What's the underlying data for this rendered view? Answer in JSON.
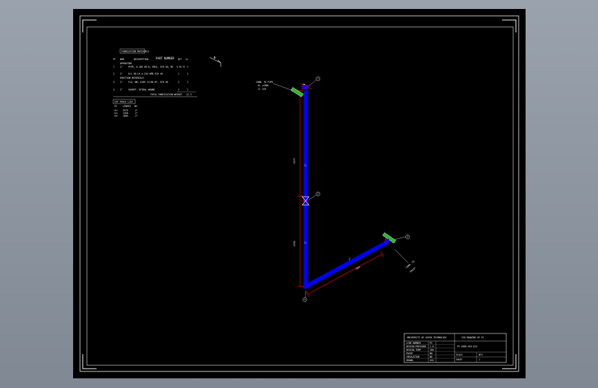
{
  "colors": {
    "background": "#8d96a1",
    "sheet": "#000000",
    "frame": "#ffffff",
    "pipe": "#0000ff",
    "dimension": "#ff0000",
    "fitting": "#2db82d"
  },
  "bom": {
    "header": "FABRICATION MATERIALS",
    "title": "PART NUMBER",
    "columns": [
      "PT",
      "NOM",
      "DESCRIPTION",
      "QTY",
      "CL"
    ],
    "rows": [
      {
        "pt": "1",
        "nom": "2\"",
        "desc": "PIPE, A-106 GR.B, SMLS, SCH 40, BE",
        "qty": "5.61 M",
        "cl": "1"
      },
      {
        "pt": "2",
        "nom": "2\"",
        "desc": "ELL 90 LR A-234 WPB SCH 40",
        "qty": "1",
        "cl": "1"
      },
      {
        "pt": "3",
        "nom": "2\"",
        "desc": "FLG, WN, A105 CL150 RF, SCH 40",
        "qty": "2",
        "cl": "1"
      },
      {
        "pt": "4",
        "nom": "2\"",
        "desc": "GASKET, SPIRAL WOUND",
        "qty": "2",
        "cl": "1"
      }
    ],
    "subtitle_1": "OPERATING",
    "subtitle_2": "ERECTION MATERIALS",
    "footer": "TOTAL FABRICATION WEIGHT",
    "footer_value": "12.3"
  },
  "cut_list": {
    "header": "CUT PIECE LIST",
    "columns": [
      "PC",
      "LENGTH",
      "NS"
    ],
    "rows": [
      [
        "<1>",
        "2575",
        "2\""
      ],
      [
        "<2>",
        "1350",
        "2\""
      ],
      [
        "<3>",
        "1685",
        "2\""
      ]
    ]
  },
  "north_arrow": {
    "label": "N"
  },
  "annotations": {
    "top_note": [
      "CONN. TO PIPE",
      "EL +4500",
      "CL 150"
    ],
    "right_note": [
      "CONN. TO",
      "EQUIP"
    ],
    "dim_upper": "2575",
    "dim_lower": "1350",
    "dim_diag": "1685",
    "pipe_label_1": "2\"",
    "pipe_label_2": "2\"",
    "pipe_label_3": "2\""
  },
  "callouts": [
    "1",
    "2",
    "3",
    "4"
  ],
  "title_block": {
    "org": "UNIVERSITY OF XXXXX TECHNOLOGY",
    "drawing_title": "ISO DRAWING OF P1",
    "drawing_no": "P1-2009-203-A13",
    "rows": [
      {
        "label": "LINE NUMBER",
        "value": "P1"
      },
      {
        "label": "DESIGN PRESSURE",
        "value": "1.0"
      },
      {
        "label": "DESIGN TEMP",
        "value": "100"
      },
      {
        "label": "PAINT",
        "value": "NO"
      },
      {
        "label": "INSULATION",
        "value": "NO"
      },
      {
        "label": "DRAWN",
        "value": "XXX"
      }
    ],
    "scale_label": "SCALE",
    "scale_value": "NTS",
    "sheet_label": "SHEET",
    "sheet_value": "1"
  }
}
